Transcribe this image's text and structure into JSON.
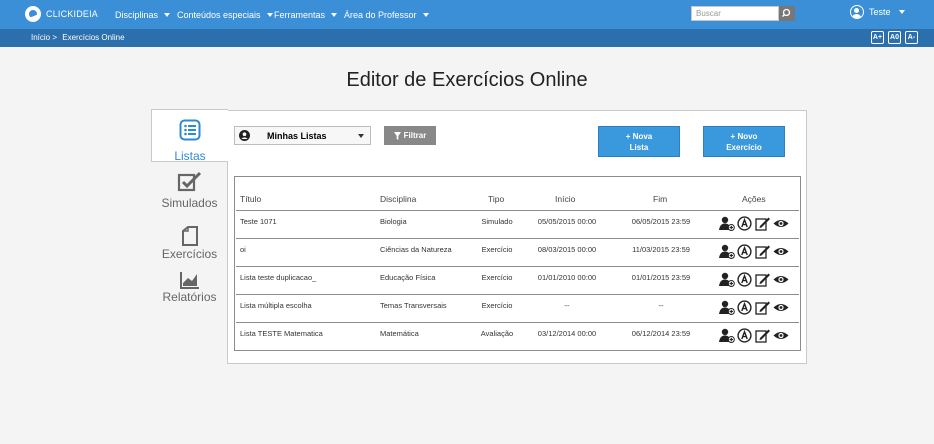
{
  "header": {
    "brand": "CLICKIDEIA",
    "menu": [
      {
        "label": "Disciplinas"
      },
      {
        "label": "Conteúdos especiais"
      },
      {
        "label": "Ferramentas"
      },
      {
        "label": "Área do Professor"
      }
    ],
    "search_placeholder": "Buscar",
    "user": "Teste"
  },
  "breadcrumb": {
    "home": "Início",
    "sep": ">",
    "current": "Exercícios Online"
  },
  "font_controls": [
    "A+",
    "A0",
    "A-"
  ],
  "page_title": "Editor de Exercícios Online",
  "tabs": {
    "active": "Listas",
    "others": [
      "Simulados",
      "Exercícios",
      "Relatórios"
    ]
  },
  "toolbar": {
    "select_value": "Minhas Listas",
    "filter_label": "Filtrar",
    "new_list": [
      "+ Nova",
      "Lista"
    ],
    "new_exercise": [
      "+ Novo",
      "Exercício"
    ]
  },
  "table": {
    "headers": [
      "Título",
      "Disciplina",
      "Tipo",
      "Início",
      "Fim",
      "Ações"
    ],
    "rows": [
      {
        "titulo": "Teste 1071",
        "disciplina": "Biologia",
        "tipo": "Simulado",
        "inicio": "05/05/2015 00:00",
        "fim": "06/05/2015 23:59"
      },
      {
        "titulo": "oi",
        "disciplina": "Ciências da Natureza",
        "tipo": "Exercício",
        "inicio": "08/03/2015 00:00",
        "fim": "11/03/2015 23:59"
      },
      {
        "titulo": "Lista teste duplicacao_",
        "disciplina": "Educação Física",
        "tipo": "Exercício",
        "inicio": "01/01/2010 00:00",
        "fim": "01/01/2015 23:59"
      },
      {
        "titulo": "Lista múltipla escolha",
        "disciplina": "Temas Transversais",
        "tipo": "Exercício",
        "inicio": "--",
        "fim": "--"
      },
      {
        "titulo": "Lista TESTE Matematica",
        "disciplina": "Matemática",
        "tipo": "Avaliação",
        "inicio": "03/12/2014 00:00",
        "fim": "06/12/2014 23:59"
      }
    ],
    "action_icons": [
      "assign-user-icon",
      "answer-key-icon",
      "edit-icon",
      "view-icon"
    ]
  },
  "colors": {
    "topbar": "#3a8fd6",
    "crumbbar": "#2b6fad",
    "accent": "#2f8ad4",
    "button": "#3a98dc"
  }
}
